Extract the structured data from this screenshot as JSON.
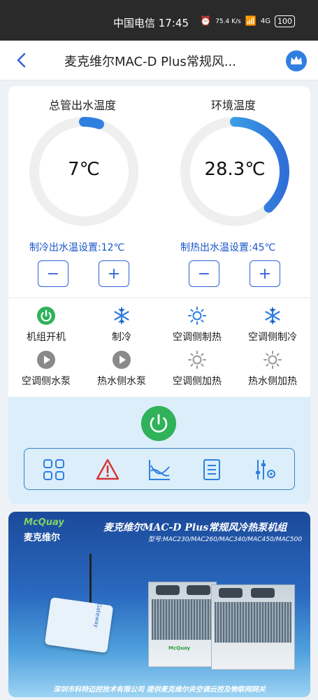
{
  "status_bar": {
    "carrier_time": "中国电信 17:45",
    "net_speed": "75.4 K/s",
    "network": "4G",
    "battery": "100"
  },
  "header": {
    "title": "麦克维尔MAC-D Plus常规风...",
    "back_icon": "back-arrow-icon",
    "crown_icon": "crown-icon"
  },
  "gauges": [
    {
      "label": "总管出水温度",
      "value": "7℃",
      "fill_fraction": 0.05,
      "setpoint_label": "制冷出水温设置:12℃",
      "minus": "−",
      "plus": "+"
    },
    {
      "label": "环境温度",
      "value": "28.3℃",
      "fill_fraction": 0.38,
      "setpoint_label": "制热出水温设置:45℃",
      "minus": "−",
      "plus": "+"
    }
  ],
  "status_items": [
    {
      "label": "机组开机",
      "icon": "power-on-icon",
      "active": true
    },
    {
      "label": "制冷",
      "icon": "snowflake-icon",
      "active": true
    },
    {
      "label": "空调侧制热",
      "icon": "sun-icon",
      "active": true
    },
    {
      "label": "空调侧制冷",
      "icon": "snowflake-icon",
      "active": true
    },
    {
      "label": "空调侧水泵",
      "icon": "play-icon",
      "active": false
    },
    {
      "label": "热水侧水泵",
      "icon": "play-icon",
      "active": false
    },
    {
      "label": "空调侧加热",
      "icon": "sun-icon",
      "active": false
    },
    {
      "label": "热水侧加热",
      "icon": "sun-icon",
      "active": false
    }
  ],
  "toolbar": [
    "grid-icon",
    "alarm-icon",
    "chart-icon",
    "list-icon",
    "settings-sliders-icon"
  ],
  "colors": {
    "accent": "#2f63d8",
    "power_green": "#2fb25a",
    "gauge_grey": "#efefef",
    "icon_blue": "#2f7fe0",
    "alarm_red": "#d93232"
  },
  "banner": {
    "brand_en": "McQuay",
    "brand_cn": "麦克维尔",
    "headline": "麦克维尔MAC-D Plus常规风冷热泵机组",
    "models": "型号:MAC230/MAC260/MAC340/MAC450/MAC500",
    "footer": "深圳市科特迈控技术有限公司   提供麦克维尔央空调云控及物联网网关",
    "gateway_label": "Gateway",
    "unit_brand": "McQuay"
  }
}
